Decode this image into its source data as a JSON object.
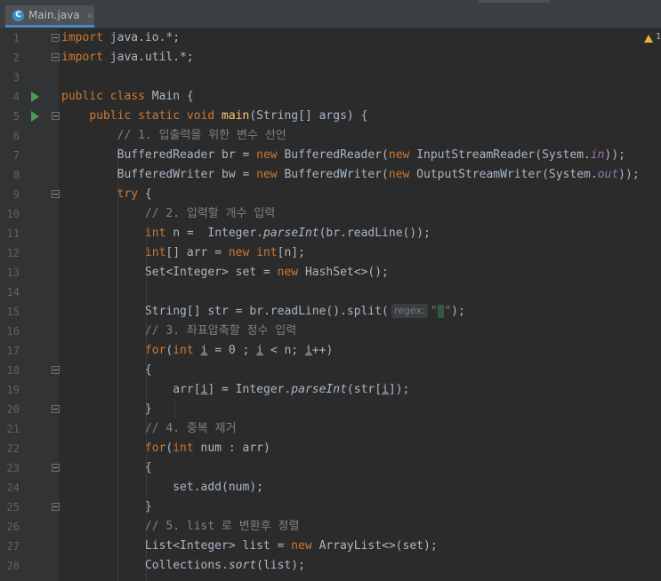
{
  "tab": {
    "file_name": "Main.java",
    "icon_letter": "C",
    "close_glyph": "×"
  },
  "inspection": {
    "icon": "warning-triangle-icon",
    "count": "1"
  },
  "editor": {
    "gutter_markers": {
      "run_lines": [
        4,
        5
      ],
      "fold_lines": [
        1,
        2,
        5,
        9,
        18,
        20,
        23,
        25
      ]
    },
    "lines": [
      {
        "n": "1",
        "tokens": [
          [
            "kw",
            "import"
          ],
          [
            "p",
            " java.io.*;"
          ]
        ]
      },
      {
        "n": "2",
        "tokens": [
          [
            "kw",
            "import"
          ],
          [
            "p",
            " java.util.*;"
          ]
        ]
      },
      {
        "n": "3",
        "tokens": []
      },
      {
        "n": "4",
        "tokens": [
          [
            "kw",
            "public class"
          ],
          [
            "p",
            " Main {"
          ]
        ]
      },
      {
        "n": "5",
        "tokens": [
          [
            "p",
            "    "
          ],
          [
            "kw",
            "public static void"
          ],
          [
            "p",
            " "
          ],
          [
            "fn",
            "main"
          ],
          [
            "p",
            "(String[] args) {"
          ]
        ]
      },
      {
        "n": "6",
        "tokens": [
          [
            "p",
            "        "
          ],
          [
            "cm",
            "// 1. 입출력을 위한 변수 선언"
          ]
        ]
      },
      {
        "n": "7",
        "tokens": [
          [
            "p",
            "        BufferedReader br = "
          ],
          [
            "kw",
            "new"
          ],
          [
            "p",
            " BufferedReader("
          ],
          [
            "kw",
            "new"
          ],
          [
            "p",
            " InputStreamReader(System."
          ],
          [
            "sf",
            "in"
          ],
          [
            "p",
            "));"
          ]
        ]
      },
      {
        "n": "8",
        "tokens": [
          [
            "p",
            "        BufferedWriter bw = "
          ],
          [
            "kw",
            "new"
          ],
          [
            "p",
            " BufferedWriter("
          ],
          [
            "kw",
            "new"
          ],
          [
            "p",
            " OutputStreamWriter(System."
          ],
          [
            "sf",
            "out"
          ],
          [
            "p",
            "));"
          ]
        ]
      },
      {
        "n": "9",
        "tokens": [
          [
            "p",
            "        "
          ],
          [
            "kw",
            "try"
          ],
          [
            "p",
            " {"
          ]
        ]
      },
      {
        "n": "10",
        "tokens": [
          [
            "p",
            "            "
          ],
          [
            "cm",
            "// 2. 입력할 개수 입력"
          ]
        ]
      },
      {
        "n": "11",
        "tokens": [
          [
            "p",
            "            "
          ],
          [
            "kw",
            "int"
          ],
          [
            "p",
            " n =  Integer."
          ],
          [
            "it",
            "parseInt"
          ],
          [
            "p",
            "(br.readLine());"
          ]
        ]
      },
      {
        "n": "12",
        "tokens": [
          [
            "p",
            "            "
          ],
          [
            "kw",
            "int"
          ],
          [
            "p",
            "[] arr = "
          ],
          [
            "kw",
            "new int"
          ],
          [
            "p",
            "[n];"
          ]
        ]
      },
      {
        "n": "13",
        "tokens": [
          [
            "p",
            "            Set<Integer> set = "
          ],
          [
            "kw",
            "new"
          ],
          [
            "p",
            " HashSet<>();"
          ]
        ]
      },
      {
        "n": "14",
        "tokens": []
      },
      {
        "n": "15",
        "tokens": [
          [
            "p",
            "            String[] str = br.readLine().split("
          ],
          [
            "hint",
            "regex:"
          ],
          [
            "st",
            "\""
          ],
          [
            "sp",
            " "
          ],
          [
            "st",
            "\""
          ],
          [
            "p",
            ");"
          ]
        ]
      },
      {
        "n": "16",
        "tokens": [
          [
            "p",
            "            "
          ],
          [
            "cm",
            "// 3. 좌표압축할 정수 입력"
          ]
        ]
      },
      {
        "n": "17",
        "tokens": [
          [
            "p",
            "            "
          ],
          [
            "kw",
            "for"
          ],
          [
            "p",
            "("
          ],
          [
            "kw",
            "int"
          ],
          [
            "p",
            " "
          ],
          [
            "ul",
            "i"
          ],
          [
            "p",
            " = 0 ; "
          ],
          [
            "ul",
            "i"
          ],
          [
            "p",
            " < n; "
          ],
          [
            "ul",
            "i"
          ],
          [
            "p",
            "++)"
          ]
        ]
      },
      {
        "n": "18",
        "tokens": [
          [
            "p",
            "            {"
          ]
        ]
      },
      {
        "n": "19",
        "tokens": [
          [
            "p",
            "                arr["
          ],
          [
            "ul",
            "i"
          ],
          [
            "p",
            "] = Integer."
          ],
          [
            "it",
            "parseInt"
          ],
          [
            "p",
            "(str["
          ],
          [
            "ul",
            "i"
          ],
          [
            "p",
            "]);"
          ]
        ]
      },
      {
        "n": "20",
        "tokens": [
          [
            "p",
            "            }"
          ]
        ]
      },
      {
        "n": "21",
        "tokens": [
          [
            "p",
            "            "
          ],
          [
            "cm",
            "// 4. 중복 제거"
          ]
        ]
      },
      {
        "n": "22",
        "tokens": [
          [
            "p",
            "            "
          ],
          [
            "kw",
            "for"
          ],
          [
            "p",
            "("
          ],
          [
            "kw",
            "int"
          ],
          [
            "p",
            " num : arr)"
          ]
        ]
      },
      {
        "n": "23",
        "tokens": [
          [
            "p",
            "            {"
          ]
        ]
      },
      {
        "n": "24",
        "tokens": [
          [
            "p",
            "                set.add(num);"
          ]
        ]
      },
      {
        "n": "25",
        "tokens": [
          [
            "p",
            "            }"
          ]
        ]
      },
      {
        "n": "26",
        "tokens": [
          [
            "p",
            "            "
          ],
          [
            "cm",
            "// 5. list 로 변환후 정렬"
          ]
        ]
      },
      {
        "n": "27",
        "tokens": [
          [
            "p",
            "            List<Integer> list = "
          ],
          [
            "kw",
            "new"
          ],
          [
            "p",
            " ArrayList<>(set);"
          ]
        ]
      },
      {
        "n": "28",
        "tokens": [
          [
            "p",
            "            Collections."
          ],
          [
            "it",
            "sort"
          ],
          [
            "p",
            "(list);"
          ]
        ]
      }
    ]
  }
}
